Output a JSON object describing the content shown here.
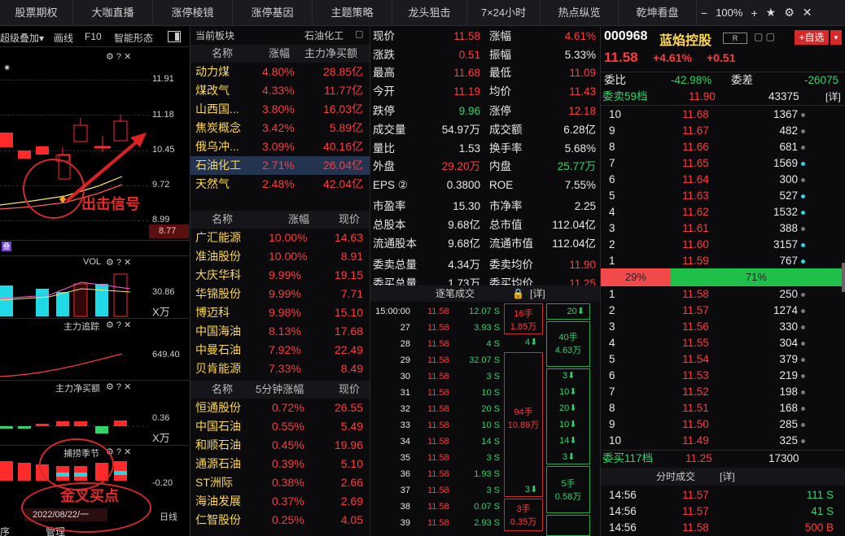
{
  "topbar": {
    "tabs": [
      "股票期权",
      "大咖直播",
      "涨停棱镜",
      "涨停基因",
      "主题策略",
      "龙头狙击",
      "7×24小时",
      "热点纵览",
      "乾坤看盘"
    ],
    "zoom": "100%",
    "minus": "−",
    "plus": "+"
  },
  "chart": {
    "toolbar": {
      "overlay": "超级叠加▾",
      "draw": "画线",
      "f10": "F10",
      "smart": "智能形态"
    },
    "price_ticks": [
      "11.91",
      "11.18",
      "10.45",
      "9.72",
      "8.99"
    ],
    "last_price": "8.77",
    "vol_label": "VOL",
    "vol_ticks": [
      "30.86",
      "X万"
    ],
    "zlzz_label": "主力追踪",
    "zlzz_tick": "649.40",
    "zljme_label": "主力净买额",
    "zljme_ticks": [
      "0.36",
      "X万"
    ],
    "bzjz_label": "捕捞季节",
    "bzjz_tick": "-0.20",
    "date": "2022/08/22/一",
    "period": "日线",
    "bottom_labels": [
      "序",
      "管理"
    ],
    "annot_signal": "出击信号",
    "annot_buy": "金叉买点",
    "purple_badge": "叠"
  },
  "sector": {
    "title": "当前板块",
    "current": "石油化工",
    "hdr1": {
      "name": "名称",
      "chg": "涨幅",
      "flow": "主力净买额"
    },
    "boards": [
      {
        "name": "动力煤",
        "chg": "4.80%",
        "flow": "28.85亿"
      },
      {
        "name": "煤改气",
        "chg": "4.33%",
        "flow": "11.77亿"
      },
      {
        "name": "山西国...",
        "chg": "3.80%",
        "flow": "16.03亿"
      },
      {
        "name": "焦炭概念",
        "chg": "3.42%",
        "flow": "5.89亿"
      },
      {
        "name": "俄乌冲...",
        "chg": "3.09%",
        "flow": "40.16亿"
      },
      {
        "name": "石油化工",
        "chg": "2.71%",
        "flow": "26.04亿"
      },
      {
        "name": "天然气",
        "chg": "2.48%",
        "flow": "42.04亿"
      }
    ],
    "hdr2": {
      "name": "名称",
      "chg": "涨幅",
      "price": "现价"
    },
    "stocks": [
      {
        "name": "广汇能源",
        "chg": "10.00%",
        "price": "14.63"
      },
      {
        "name": "准油股份",
        "chg": "10.00%",
        "price": "8.91"
      },
      {
        "name": "大庆华科",
        "chg": "9.99%",
        "price": "19.15"
      },
      {
        "name": "华锦股份",
        "chg": "9.99%",
        "price": "7.71"
      },
      {
        "name": "博迈科",
        "chg": "9.98%",
        "price": "15.10"
      },
      {
        "name": "中国海油",
        "chg": "8.13%",
        "price": "17.68"
      },
      {
        "name": "中曼石油",
        "chg": "7.92%",
        "price": "22.49"
      },
      {
        "name": "贝肯能源",
        "chg": "7.33%",
        "price": "8.49"
      }
    ],
    "hdr3": {
      "name": "名称",
      "chg": "5分钟涨幅",
      "price": "现价"
    },
    "stocks5": [
      {
        "name": "恒通股份",
        "chg": "0.72%",
        "price": "26.55"
      },
      {
        "name": "中国石油",
        "chg": "0.55%",
        "price": "5.49"
      },
      {
        "name": "和顺石油",
        "chg": "0.45%",
        "price": "19.96"
      },
      {
        "name": "通源石油",
        "chg": "0.39%",
        "price": "5.10"
      },
      {
        "name": "ST洲际",
        "chg": "0.38%",
        "price": "2.66"
      },
      {
        "name": "海油发展",
        "chg": "0.37%",
        "price": "2.69"
      },
      {
        "name": "仁智股份",
        "chg": "0.25%",
        "price": "4.05"
      }
    ]
  },
  "quote": {
    "rows": [
      {
        "l1": "现价",
        "v1": "11.58",
        "l2": "涨幅",
        "v2": "4.61%"
      },
      {
        "l1": "涨跌",
        "v1": "0.51",
        "l2": "振幅",
        "v2": "5.33%"
      },
      {
        "l1": "最高",
        "v1": "11.68",
        "l2": "最低",
        "v2": "11.09"
      },
      {
        "l1": "今开",
        "v1": "11.19",
        "l2": "均价",
        "v2": "11.43"
      },
      {
        "l1": "跌停",
        "v1": "9.96",
        "l2": "涨停",
        "v2": "12.18"
      },
      {
        "l1": "成交量",
        "v1": "54.97万",
        "l2": "成交额",
        "v2": "6.28亿"
      },
      {
        "l1": "量比",
        "v1": "1.53",
        "l2": "换手率",
        "v2": "5.68%"
      },
      {
        "l1": "外盘",
        "v1": "29.20万",
        "l2": "内盘",
        "v2": "25.77万"
      },
      {
        "l1": "EPS ②",
        "v1": "0.3800",
        "l2": "ROE",
        "v2": "7.55%"
      },
      {
        "l1": "市盈率",
        "v1": "15.30",
        "l2": "市净率",
        "v2": "2.25"
      },
      {
        "l1": "总股本",
        "v1": "9.68亿",
        "l2": "总市值",
        "v2": "112.04亿"
      },
      {
        "l1": "流通股本",
        "v1": "9.68亿",
        "l2": "流通市值",
        "v2": "112.04亿"
      },
      {
        "l1": "委卖总量",
        "v1": "4.34万",
        "l2": "委卖均价",
        "v2": "11.90"
      },
      {
        "l1": "委买总量",
        "v1": "1.73万",
        "l2": "委买均价",
        "v2": "11.25"
      }
    ],
    "trades_title": "逐笔成交",
    "trades_detail": "[详]",
    "trades": [
      {
        "t": "15:00:00",
        "p": "11.58",
        "v": "12.07 S"
      },
      {
        "t": "27",
        "p": "11.58",
        "v": "3.93 S"
      },
      {
        "t": "28",
        "p": "11.58",
        "v": "4 S"
      },
      {
        "t": "29",
        "p": "11.58",
        "v": "32.07 S"
      },
      {
        "t": "30",
        "p": "11.58",
        "v": "3 S"
      },
      {
        "t": "31",
        "p": "11.58",
        "v": "10 S"
      },
      {
        "t": "32",
        "p": "11.58",
        "v": "20 S"
      },
      {
        "t": "33",
        "p": "11.58",
        "v": "10 S"
      },
      {
        "t": "34",
        "p": "11.58",
        "v": "14 S"
      },
      {
        "t": "35",
        "p": "11.58",
        "v": "3 S"
      },
      {
        "t": "36",
        "p": "11.58",
        "v": "1.93 S"
      },
      {
        "t": "37",
        "p": "11.58",
        "v": "3 S"
      },
      {
        "t": "38",
        "p": "11.58",
        "v": "0.07 S"
      },
      {
        "t": "39",
        "p": "11.58",
        "v": "2.93 S"
      }
    ],
    "boxes": {
      "b1a": "16手",
      "b1b": "1.85万",
      "b2a": "94手",
      "b2b": "10.89万",
      "b3a": "3手",
      "b3b": "0.35万",
      "g1": "20⬇",
      "g2a": "40手",
      "g2b": "4.63万",
      "g3": "4⬇",
      "g4": "3⬇",
      "g5": "10⬇",
      "g6": "20⬇",
      "g7": "10⬇",
      "g8": "14⬇",
      "g9": "3⬇",
      "g10a": "5手",
      "g10b": "0.58万",
      "g11": "3⬇"
    }
  },
  "book": {
    "code": "000968",
    "name": "蓝焰控股",
    "r_badge": "R",
    "add_btn": "+自选",
    "price": "11.58",
    "chg_pct": "+4.61%",
    "chg": "+0.51",
    "weibi_l": "委比",
    "weibi_v": "-42.98%",
    "weicha_l": "委差",
    "weicha_v": "-26075",
    "sell_label": "委卖59档",
    "sell_price": "11.90",
    "sell_vol": "43375",
    "detail": "[详]",
    "sells": [
      {
        "n": "10",
        "p": "11.68",
        "v": "1367",
        "dot": "gray"
      },
      {
        "n": "9",
        "p": "11.67",
        "v": "482",
        "dot": "gray"
      },
      {
        "n": "8",
        "p": "11.66",
        "v": "681",
        "dot": "gray"
      },
      {
        "n": "7",
        "p": "11.65",
        "v": "1569",
        "dot": "cyan"
      },
      {
        "n": "6",
        "p": "11.64",
        "v": "300",
        "dot": "gray"
      },
      {
        "n": "5",
        "p": "11.63",
        "v": "527",
        "dot": "cyan"
      },
      {
        "n": "4",
        "p": "11.62",
        "v": "1532",
        "dot": "cyan"
      },
      {
        "n": "3",
        "p": "11.61",
        "v": "388",
        "dot": "gray"
      },
      {
        "n": "2",
        "p": "11.60",
        "v": "3157",
        "dot": "cyan"
      },
      {
        "n": "1",
        "p": "11.59",
        "v": "767",
        "dot": "cyan"
      }
    ],
    "bar_sell": "29%",
    "bar_buy": "71%",
    "bar_ratio": 0.29,
    "buys": [
      {
        "n": "1",
        "p": "11.58",
        "v": "250",
        "dot": "gray"
      },
      {
        "n": "2",
        "p": "11.57",
        "v": "1274",
        "dot": "gray"
      },
      {
        "n": "3",
        "p": "11.56",
        "v": "330",
        "dot": "gray"
      },
      {
        "n": "4",
        "p": "11.55",
        "v": "304",
        "dot": "gray"
      },
      {
        "n": "5",
        "p": "11.54",
        "v": "379",
        "dot": "gray"
      },
      {
        "n": "6",
        "p": "11.53",
        "v": "219",
        "dot": "gray"
      },
      {
        "n": "7",
        "p": "11.52",
        "v": "198",
        "dot": "gray"
      },
      {
        "n": "8",
        "p": "11.51",
        "v": "168",
        "dot": "gray"
      },
      {
        "n": "9",
        "p": "11.50",
        "v": "285",
        "dot": "gray"
      },
      {
        "n": "10",
        "p": "11.49",
        "v": "325",
        "dot": "gray"
      }
    ],
    "buy_label": "委买117档",
    "buy_price": "11.25",
    "buy_vol": "17300",
    "fen_title": "分时成交",
    "fen_detail": "[详]",
    "fen": [
      {
        "t": "14:56",
        "p": "11.57",
        "v": "111 S"
      },
      {
        "t": "14:56",
        "p": "11.57",
        "v": "41 S"
      },
      {
        "t": "14:56",
        "p": "11.58",
        "v": "500 B"
      }
    ]
  }
}
